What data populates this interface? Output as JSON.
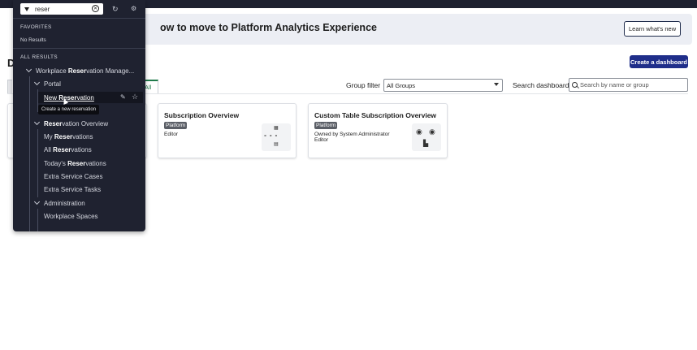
{
  "banner": {
    "title": "ow to move to Platform Analytics Experience",
    "learn_button": "Learn what's new"
  },
  "page": {
    "title_partial": "D",
    "create_button": "Create a dashboard",
    "tab_all": "All"
  },
  "filters": {
    "group_filter_label": "Group filter",
    "group_filter_value": "All Groups",
    "search_label": "Search dashboard",
    "search_placeholder": "Search by name or group"
  },
  "cards": [
    {
      "title": "Subscription Overview",
      "badge": "Platform",
      "lines": [
        "Editor"
      ]
    },
    {
      "title": "Custom Table Subscription Overview",
      "badge": "Platform",
      "lines": [
        "Owned by System Administrator",
        "Editor"
      ]
    }
  ],
  "nav": {
    "search_value": "reser",
    "favorites_heading": "FAVORITES",
    "favorites_empty": "No Results",
    "all_results_heading": "ALL RESULTS",
    "app": {
      "pre": "Workplace ",
      "match": "Reser",
      "post": "vation Manage..."
    },
    "portal": "Portal",
    "new_res": {
      "pre": "New ",
      "match": "Reser",
      "post": "vation"
    },
    "tooltip": "Create a new reservation",
    "overview": {
      "pre": "",
      "match": "Reser",
      "post": "vation Overview"
    },
    "my_res": {
      "pre": "My ",
      "match": "Reser",
      "post": "vations"
    },
    "all_res": {
      "pre": "All ",
      "match": "Reser",
      "post": "vations"
    },
    "today_res": {
      "pre": "Today's ",
      "match": "Reser",
      "post": "vations"
    },
    "extra_cases": "Extra Service Cases",
    "extra_tasks": "Extra Service Tasks",
    "administration": "Administration",
    "workplace_spaces": "Workplace Spaces"
  },
  "icons": [
    "filter-icon",
    "clear-icon",
    "refresh-icon",
    "settings-icon",
    "edit-icon",
    "star-icon",
    "search-icon",
    "chevron-down-icon"
  ]
}
